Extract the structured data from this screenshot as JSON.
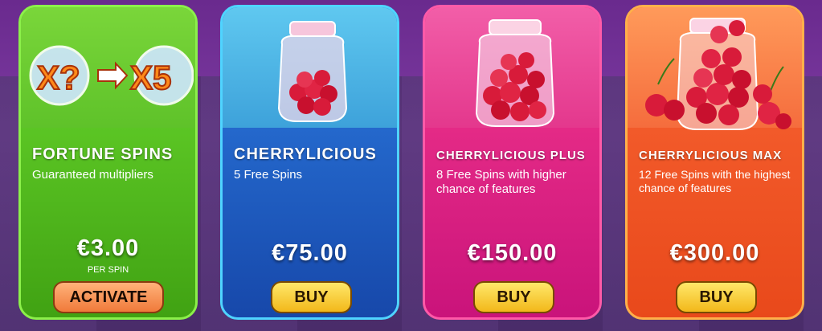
{
  "cards": [
    {
      "title": "FORTUNE SPINS",
      "description": "Guaranteed multipliers",
      "price": "€3.00",
      "price_note": "PER SPIN",
      "button": "ACTIVATE",
      "badge_from": "X?",
      "badge_to": "X5"
    },
    {
      "title": "CHERRYLICIOUS",
      "description": "5 Free Spins",
      "price": "€75.00",
      "button": "BUY"
    },
    {
      "title": "CHERRYLICIOUS PLUS",
      "description": "8 Free Spins with higher chance of features",
      "price": "€150.00",
      "button": "BUY"
    },
    {
      "title": "CHERRYLICIOUS MAX",
      "description": "12 Free Spins with the highest chance of features",
      "price": "€300.00",
      "button": "BUY"
    }
  ],
  "colors": {
    "green": "#56c41c",
    "blue": "#1f5fc4",
    "pink": "#e2237a",
    "orange": "#f05a28",
    "button_yellow": "#f7d13a"
  }
}
